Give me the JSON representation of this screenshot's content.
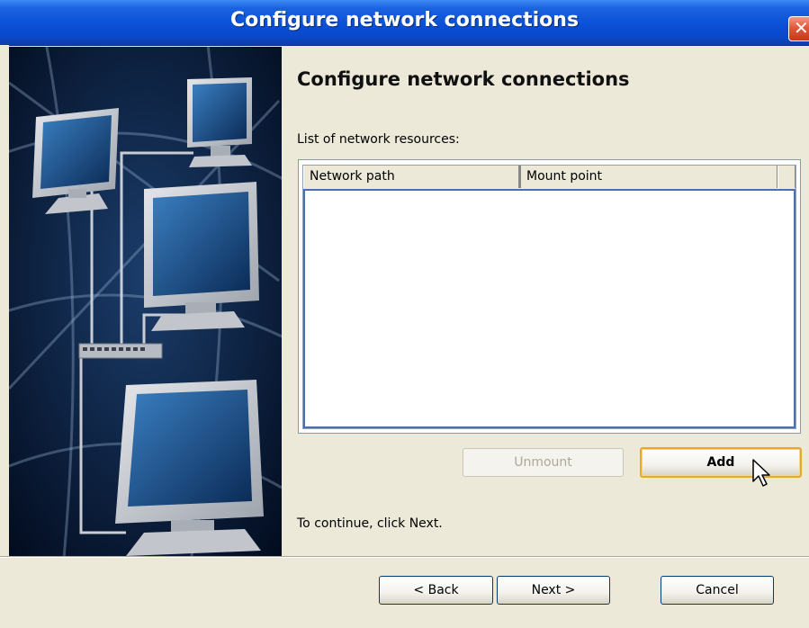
{
  "window": {
    "title": "Configure network connections",
    "close_icon": "close-icon"
  },
  "main": {
    "heading": "Configure network connections",
    "list_label": "List of network resources:",
    "list": {
      "columns": [
        "Network path",
        "Mount point",
        ""
      ],
      "rows": []
    },
    "unmount_label": "Unmount",
    "add_label": "Add",
    "continue_text": "To continue, click Next."
  },
  "footer": {
    "back_label": "< Back",
    "next_label": "Next >",
    "cancel_label": "Cancel"
  },
  "colors": {
    "titlebar": "#0b50d8",
    "close": "#e2583a",
    "art_background": "#03142e",
    "dialog_background": "#ece9d8",
    "add_focus_border": "#e8a830"
  }
}
